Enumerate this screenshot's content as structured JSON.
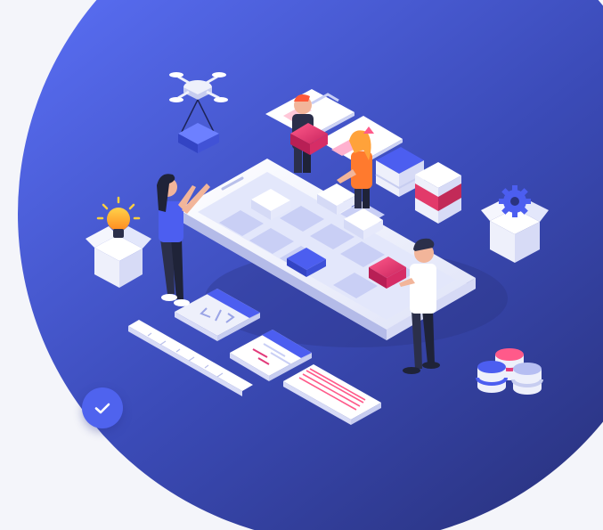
{
  "colors": {
    "background": "#f4f5fa",
    "circle_top": "#5468f0",
    "circle_bottom": "#2a3583",
    "accent_blue": "#4c5ef0",
    "accent_pink": "#e23a7a",
    "accent_orange": "#ff7a2e",
    "phone_body": "#eef0fb",
    "badge": "#4f63ee"
  },
  "icons": {
    "check_badge": "check-icon",
    "drone": "drone-icon",
    "lightbulb": "lightbulb-icon",
    "gear": "gear-icon",
    "database": "database-icon",
    "code": "code-icon"
  }
}
